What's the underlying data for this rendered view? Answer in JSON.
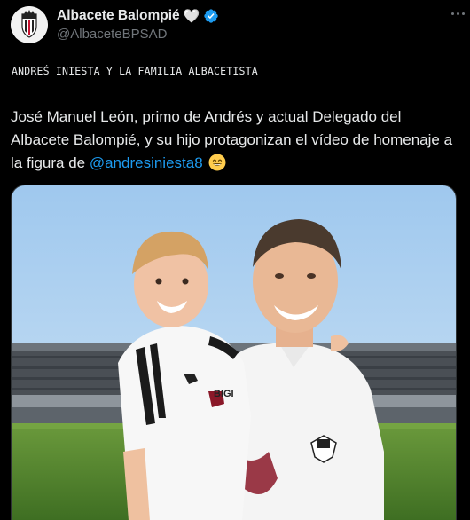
{
  "author": {
    "display_name": "Albacete Balompié",
    "handle": "@AlbaceteBPSAD",
    "heart_emoji": "🤍"
  },
  "tweet": {
    "kicker": "ANDREŚ INIESTA Y LA FAMILIA ALBACETISTA",
    "text_before_mention": " José Manuel León, primo de Andrés y actual Delegado del Albacete Balompié, y su hijo protagonizan el vídeo de homenaje a la figura de ",
    "mention": "@andresiniesta8",
    "jersey_sponsor": "BIGI"
  },
  "icons": {
    "more": "more-horizontal-icon",
    "verified": "verified-badge-icon",
    "emoji": "grinning-face-emoji"
  },
  "colors": {
    "background": "#000000",
    "text": "#e7e9ea",
    "muted": "#71767b",
    "link": "#1d9bf0",
    "verified": "#1d9bf0"
  }
}
